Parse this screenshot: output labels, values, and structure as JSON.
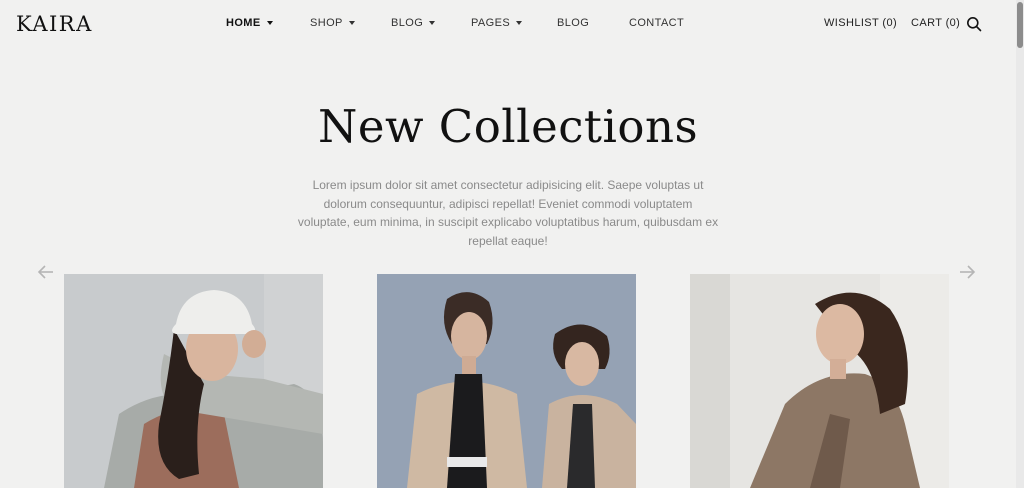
{
  "header": {
    "logo": "KAIRA",
    "nav": [
      {
        "label": "HOME",
        "dropdown": true,
        "active": true
      },
      {
        "label": "SHOP",
        "dropdown": true
      },
      {
        "label": "BLOG",
        "dropdown": true
      },
      {
        "label": "PAGES",
        "dropdown": true
      },
      {
        "label": "BLOG",
        "dropdown": false
      },
      {
        "label": "CONTACT",
        "dropdown": false
      }
    ],
    "wishlist": "WISHLIST (0)",
    "cart": "CART (0)",
    "search_icon": "search-icon"
  },
  "hero": {
    "title": "New Collections",
    "description": "Lorem ipsum dolor sit amet consectetur adipisicing elit. Saepe voluptas ut dolorum consequuntur, adipisci repellat! Eveniet commodi voluptatem voluptate, eum minima, in suscipit explicabo voluptatibus harum, quibusdam ex repellat eaque!"
  },
  "carousel": {
    "prev_icon": "arrow-left-icon",
    "next_icon": "arrow-right-icon",
    "items": [
      {
        "image": "woman-in-white-bucket-hat"
      },
      {
        "image": "two-women-in-beige-jackets"
      },
      {
        "image": "woman-in-brown-jacket-leaning"
      }
    ]
  },
  "colors": {
    "background": "#f1f1f0",
    "text": "#111111",
    "muted": "#8a8a8a"
  }
}
